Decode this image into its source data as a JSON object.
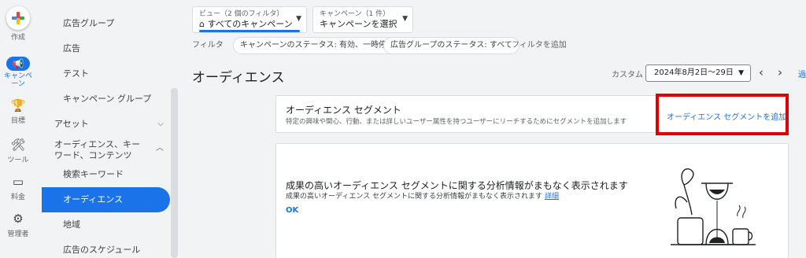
{
  "rail": {
    "create": "作成",
    "campaigns": "キャンペーン",
    "goals": "目標",
    "tools": "ツール",
    "billing": "料金",
    "admin": "管理者"
  },
  "nav": {
    "items": [
      {
        "label": "広告グループ"
      },
      {
        "label": "広告"
      },
      {
        "label": "テスト"
      },
      {
        "label": "キャンペーン グループ"
      },
      {
        "label": "アセット"
      },
      {
        "label": "オーディエンス、キーワード、コンテンツ"
      },
      {
        "label": "検索キーワード"
      },
      {
        "label": "オーディエンス"
      },
      {
        "label": "地域"
      },
      {
        "label": "広告のスケジュール"
      }
    ]
  },
  "header": {
    "view_label": "ビュー（2 個のフィルタ）",
    "view_value": "すべてのキャンペーン",
    "campaign_label": "キャンペーン（1 件）",
    "campaign_value": "キャンペーンを選択"
  },
  "filters": {
    "label": "フィルタ",
    "chips": [
      "キャンペーンのステータス: 有効、一時停止",
      "広告グループのステータス: すべて"
    ],
    "add": "フィルタを追加"
  },
  "page": {
    "title": "オーディエンス",
    "custom_label": "カスタム",
    "date_range": "2024年8月2日〜29日",
    "more": "過"
  },
  "segment_card": {
    "title": "オーディエンス セグメント",
    "subtitle": "特定の興味や関心、行動、または詳しいユーザー属性を持つユーザーにリーチするためにセグメントを追加します",
    "add_link": "オーディエンス セグメントを追加"
  },
  "insight_card": {
    "title": "成果の高いオーディエンス セグメントに関する分析情報がまもなく表示されます",
    "subtitle": "成果の高いオーディエンス セグメントに関する分析情報がまもなく表示されます",
    "details": "詳細",
    "ok": "OK"
  },
  "colors": {
    "accent": "#1a73e8",
    "highlight": "#e00000"
  }
}
